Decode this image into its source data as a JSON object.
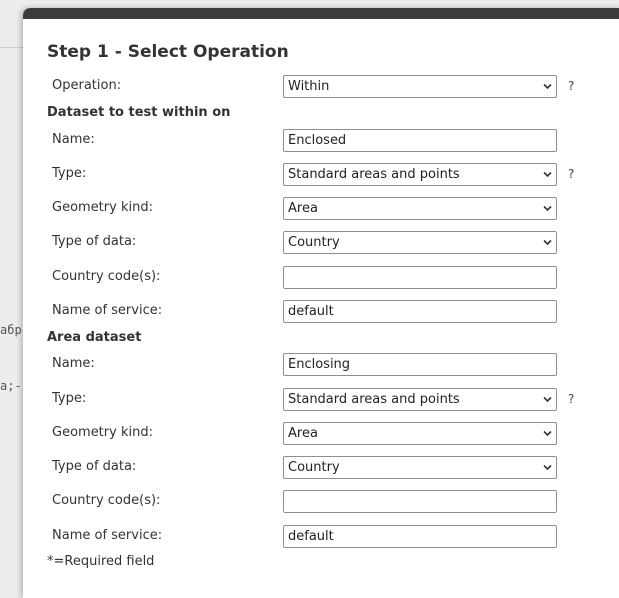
{
  "background": {
    "code_fragment_1": "абр",
    "code_fragment_2": "a;-"
  },
  "dialog": {
    "title": "Step 1 - Select Operation",
    "operation": {
      "label": "Operation:",
      "value": "Within",
      "help": "?"
    },
    "dataset_section": {
      "header": "Dataset to test within on",
      "name_label": "Name:",
      "name_value": "Enclosed",
      "type_label": "Type:",
      "type_value": "Standard areas and points",
      "type_help": "?",
      "geometry_label": "Geometry kind:",
      "geometry_value": "Area",
      "datatype_label": "Type of data:",
      "datatype_value": "Country",
      "country_codes_label": "Country code(s):",
      "country_codes_value": "",
      "service_label": "Name of service:",
      "service_value": "default"
    },
    "area_section": {
      "header": "Area dataset",
      "name_label": "Name:",
      "name_value": "Enclosing",
      "type_label": "Type:",
      "type_value": "Standard areas and points",
      "type_help": "?",
      "geometry_label": "Geometry kind:",
      "geometry_value": "Area",
      "datatype_label": "Type of data:",
      "datatype_value": "Country",
      "country_codes_label": "Country code(s):",
      "country_codes_value": "",
      "service_label": "Name of service:",
      "service_value": "default"
    },
    "required_note": "*=Required field"
  }
}
